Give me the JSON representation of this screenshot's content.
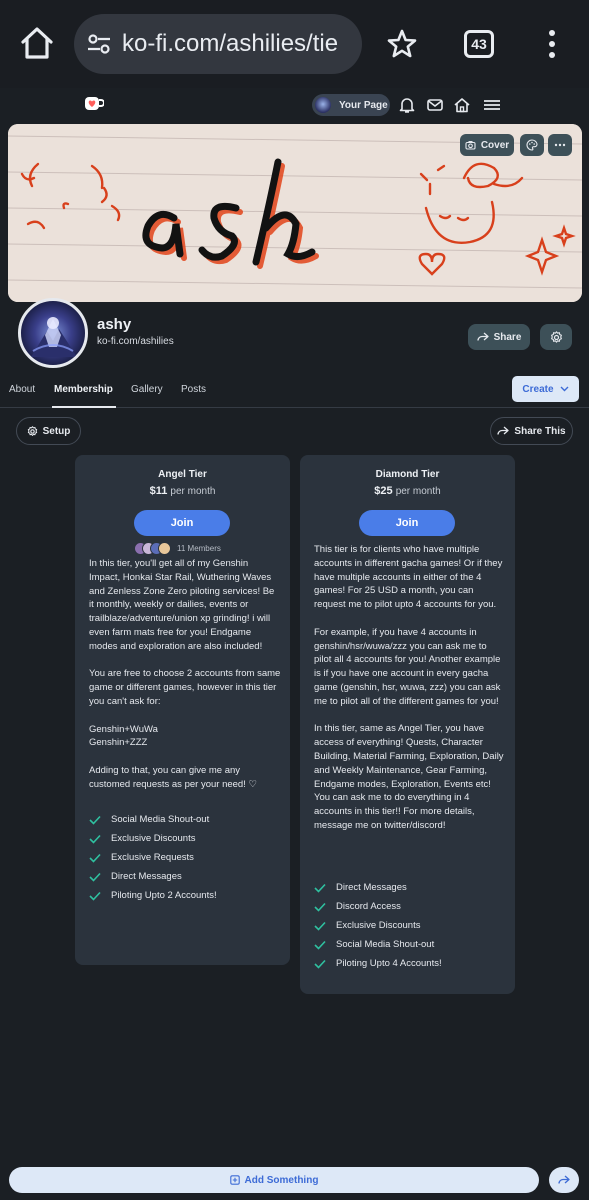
{
  "browser": {
    "url": "ko-fi.com/ashilies/tie",
    "tab_count": "43"
  },
  "nav": {
    "your_page_label": "Your Page"
  },
  "cover": {
    "cover_label": "Cover",
    "handwriting_text": "ash"
  },
  "profile": {
    "name": "ashy",
    "url": "ko-fi.com/ashilies",
    "share_label": "Share"
  },
  "tabs": [
    {
      "label": "About"
    },
    {
      "label": "Membership"
    },
    {
      "label": "Gallery"
    },
    {
      "label": "Posts"
    }
  ],
  "create_label": "Create",
  "setup_label": "Setup",
  "share_this_label": "Share This",
  "tiers": [
    {
      "title": "Angel Tier",
      "price": "$11",
      "period": "per month",
      "join_label": "Join",
      "members": "11 Members",
      "description": "In this tier, you'll get all of my Genshin Impact, Honkai Star Rail, Wuthering Waves and Zenless Zone Zero piloting services! Be it monthly, weekly or dailies, events or trailblaze/adventure/union xp grinding! i will even farm mats free for you! Endgame modes and exploration are also included!\n\nYou are free to choose 2 accounts from same game or different games, however in this tier you can't ask for:\n\nGenshin+WuWa\nGenshin+ZZZ\n\nAdding to that, you can give me any customed requests as per your need! ♡",
      "perks": [
        "Social Media Shout-out",
        "Exclusive Discounts",
        "Exclusive Requests",
        "Direct Messages",
        "Piloting Upto 2 Accounts!"
      ]
    },
    {
      "title": "Diamond Tier",
      "price": "$25",
      "period": "per month",
      "join_label": "Join",
      "description": "This tier is for clients who have multiple accounts in different gacha games! Or if they have multiple accounts in either of the 4 games! For 25 USD a month, you can request me to pilot upto 4 accounts for you.\n\nFor example, if you have 4 accounts in genshin/hsr/wuwa/zzz you can ask me to pilot all 4 accounts for you! Another example is if you have one account in every gacha game (genshin, hsr, wuwa, zzz) you can ask me to pilot all of the different games for you!\n\nIn this tier, same as Angel Tier, you have access of everything! Quests, Character Building, Material Farming, Exploration, Daily and Weekly Maintenance, Gear Farming, Endgame modes, Exploration, Events etc! You can ask me to do everything in 4 accounts in this tier!! For more details, message me on twitter/discord!",
      "perks": [
        "Direct Messages",
        "Discord Access",
        "Exclusive Discounts",
        "Social Media Shout-out",
        "Piloting Upto 4 Accounts!"
      ]
    }
  ],
  "bottom": {
    "add_label": "Add Something"
  },
  "colors": {
    "background": "#1b1f24",
    "card": "#2b333d",
    "accent": "#4a7de8",
    "check": "#2fc1a0"
  }
}
